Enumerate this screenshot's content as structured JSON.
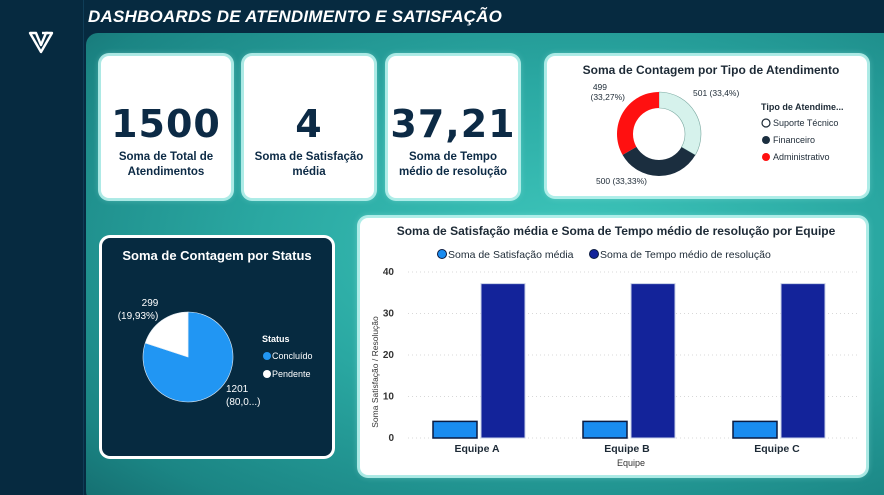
{
  "header": {
    "title": "DASHBOARDS DE ATENDIMENTO E SATISFAÇÃO"
  },
  "logo": {
    "icon": "brand-logo-icon"
  },
  "kpis": [
    {
      "value": "1500",
      "label": "Soma de Total de Atendimentos"
    },
    {
      "value": "4",
      "label": "Soma de Satisfação média"
    },
    {
      "value": "37,21",
      "label": "Soma de Tempo médio de resolução"
    }
  ],
  "colors": {
    "suporte": "#d6f2ec",
    "financeiro": "#1b2e3f",
    "administrativo": "#ff1010",
    "concluido": "#2196f3",
    "pendente": "#ffffff",
    "satisfacao": "#1a8cf0",
    "tempo": "#13239a"
  },
  "chart_data": [
    {
      "type": "pie",
      "variant": "donut",
      "title": "Soma de Contagem por Tipo de Atendimento",
      "legend_title": "Tipo de Atendime...",
      "slices": [
        {
          "name": "Suporte Técnico",
          "value": 501,
          "label": "501 (33,4%)",
          "color": "#d6f2ec"
        },
        {
          "name": "Financeiro",
          "value": 500,
          "label": "500 (33,33%)",
          "color": "#1b2e3f"
        },
        {
          "name": "Administrativo",
          "value": 499,
          "label": "499 (33,27%)",
          "color": "#ff1010"
        }
      ]
    },
    {
      "type": "pie",
      "title": "Soma de Contagem por Status",
      "legend_title": "Status",
      "slices": [
        {
          "name": "Concluído",
          "value": 1201,
          "label": "1201 (80,0...)",
          "color": "#2196f3"
        },
        {
          "name": "Pendente",
          "value": 299,
          "label": "299 (19,93%)",
          "color": "#ffffff"
        }
      ]
    },
    {
      "type": "bar",
      "title": "Soma de Satisfação média e Soma de Tempo médio de resolução por Equipe",
      "xlabel": "Equipe",
      "ylabel": "Soma Satisfação / Resolução",
      "categories": [
        "Equipe A",
        "Equipe B",
        "Equipe C"
      ],
      "series": [
        {
          "name": "Soma de Satisfação média",
          "values": [
            4,
            4,
            4
          ],
          "color": "#1a8cf0"
        },
        {
          "name": "Soma de Tempo médio de resolução",
          "values": [
            37.2,
            37.2,
            37.2
          ],
          "color": "#13239a"
        }
      ],
      "ylim": [
        0,
        40
      ],
      "yticks": [
        "0",
        "10",
        "20",
        "30",
        "40"
      ],
      "grid": true,
      "legend_position": "top"
    }
  ]
}
